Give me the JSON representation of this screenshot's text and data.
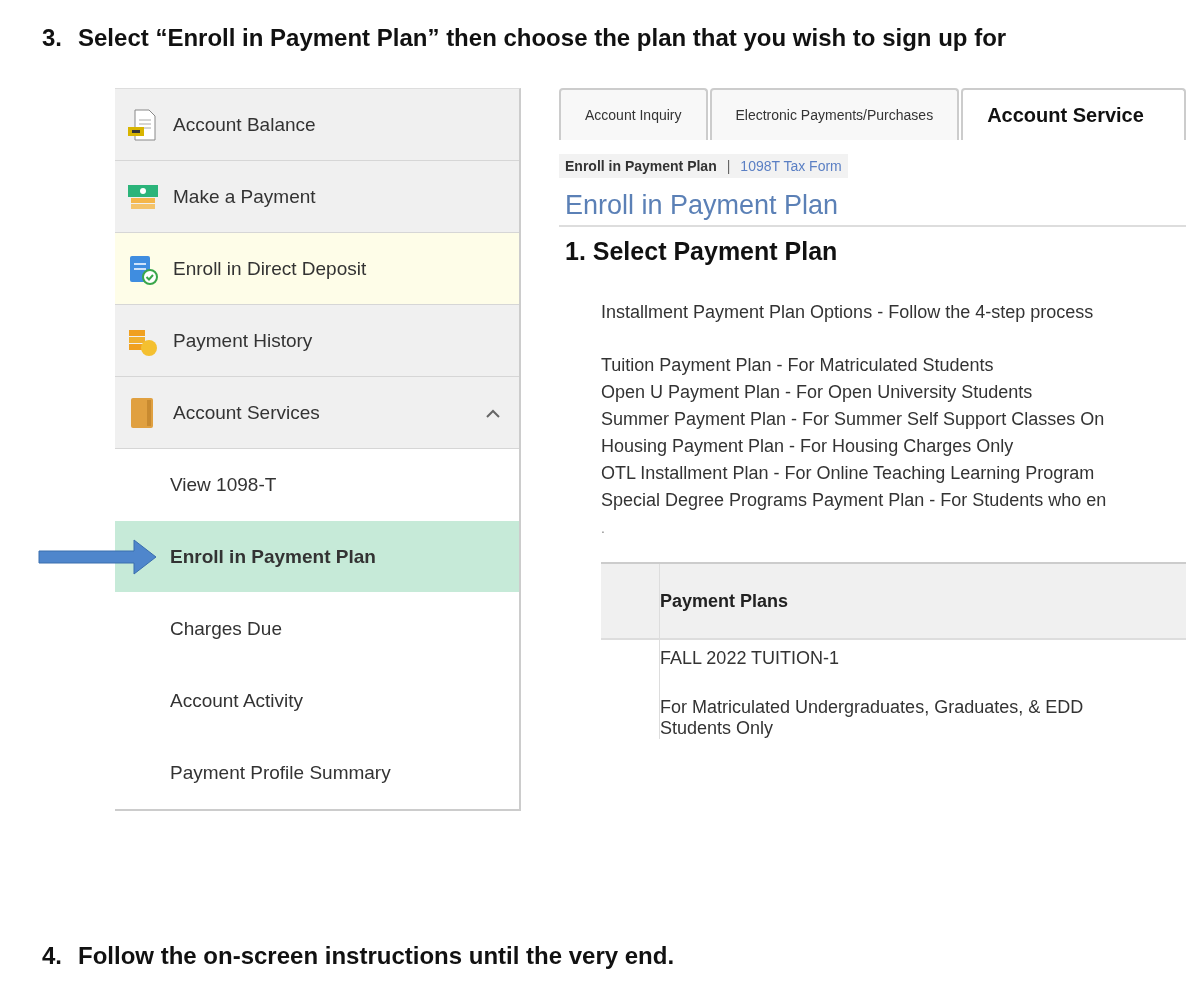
{
  "steps": [
    {
      "number": "3.",
      "text": "Select “Enroll in Payment Plan” then choose the plan that you wish to sign up for"
    },
    {
      "number": "4.",
      "text": "Follow the on-screen instructions until the very end."
    }
  ],
  "sidebar": {
    "items": [
      {
        "kind": "main",
        "label": "Account Balance",
        "selected": false,
        "highlighted": false
      },
      {
        "kind": "main",
        "label": "Make a Payment",
        "selected": false,
        "highlighted": false
      },
      {
        "kind": "main",
        "label": "Enroll in Direct Deposit",
        "selected": false,
        "highlighted": true
      },
      {
        "kind": "main",
        "label": "Payment History",
        "selected": false,
        "highlighted": false
      },
      {
        "kind": "main",
        "label": "Account Services",
        "selected": false,
        "highlighted": false,
        "expanded": true,
        "children": [
          {
            "kind": "sub",
            "label": "View 1098-T",
            "selected": false,
            "highlighted": false
          },
          {
            "kind": "sub",
            "label": "Enroll in Payment Plan",
            "selected": true,
            "highlighted": false
          },
          {
            "kind": "sub",
            "label": "Charges Due",
            "selected": false,
            "highlighted": false
          },
          {
            "kind": "sub",
            "label": "Account Activity",
            "selected": false,
            "highlighted": false
          },
          {
            "kind": "sub",
            "label": "Payment Profile Summary",
            "selected": false,
            "highlighted": false
          }
        ]
      }
    ]
  },
  "tabs": [
    {
      "label": "Account Inquiry",
      "selected": false
    },
    {
      "label": "Electronic Payments/Purchases",
      "selected": false
    },
    {
      "label": "Account Service",
      "selected": true
    }
  ],
  "subnav": [
    {
      "label": "Enroll in Payment Plan",
      "selected": true
    },
    {
      "label": "1098T Tax Form",
      "selected": false
    }
  ],
  "subnav_separator": "|",
  "page_title": "Enroll in Payment Plan",
  "section_title": "1. Select Payment Plan",
  "intro": "Installment Payment Plan Options - Follow the 4-step process",
  "plan_options": [
    "Tuition Payment Plan - For Matriculated Students",
    "Open U Payment Plan - For Open University Students",
    "Summer Payment Plan - For Summer Self Support Classes On",
    "Housing Payment Plan - For Housing Charges Only",
    "OTL Installment Plan - For Online Teaching Learning Program",
    "Special Degree Programs Payment Plan - For Students who en"
  ],
  "stray_mark": ".",
  "table": {
    "columns": [
      "Payment Plans"
    ],
    "rows": [
      {
        "name": "FALL 2022 TUITION-1",
        "description": "For Matriculated Undergraduates, Graduates, & EDD Students Only"
      }
    ]
  }
}
